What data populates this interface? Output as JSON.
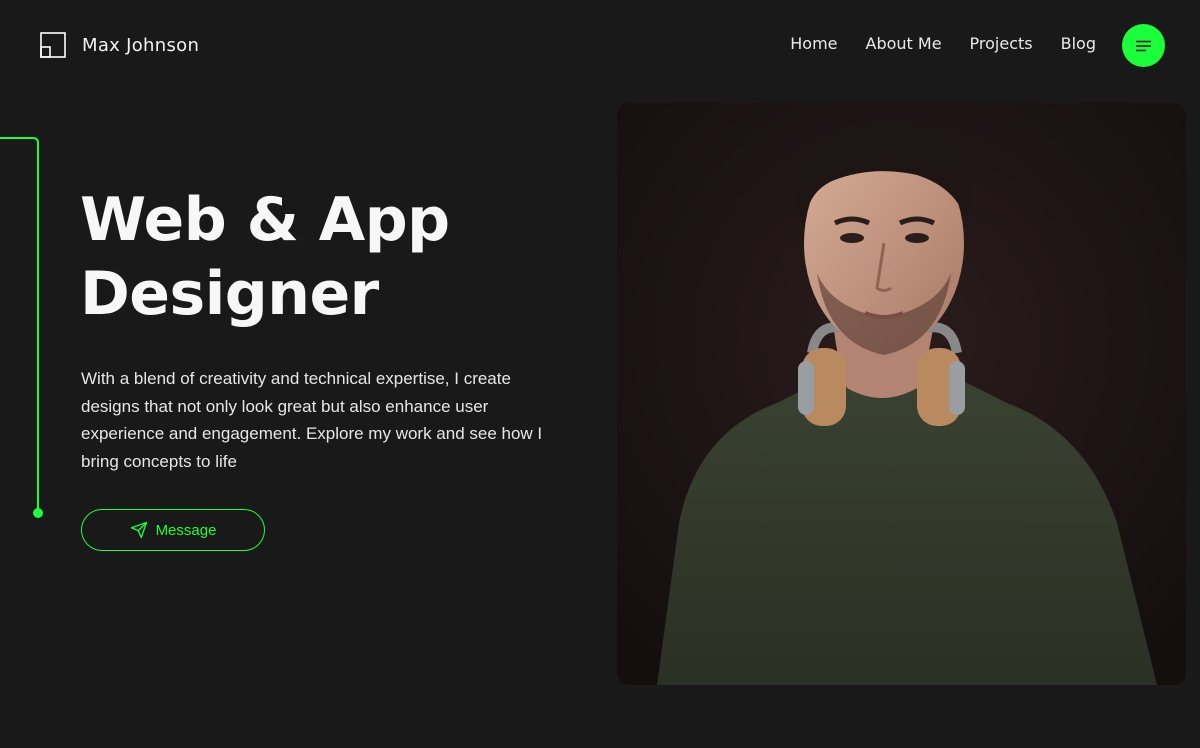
{
  "header": {
    "logo_icon": "square-logo-icon",
    "brand_name": "Max Johnson",
    "nav": [
      {
        "label": "Home"
      },
      {
        "label": "About Me"
      },
      {
        "label": "Projects"
      },
      {
        "label": "Blog"
      }
    ],
    "menu_icon": "menu-icon"
  },
  "hero": {
    "title_line1": "Web & App",
    "title_line2": "Designer",
    "description": "With a blend of creativity and technical expertise, I create designs that not only look great but also enhance user experience and engagement. Explore my work and see how I bring concepts to life",
    "cta_label": "Message",
    "cta_icon": "send-icon",
    "photo_icon": "portrait-photo"
  },
  "colors": {
    "background": "#191919",
    "accent": "#1aff3a",
    "text": "#ffffff"
  }
}
